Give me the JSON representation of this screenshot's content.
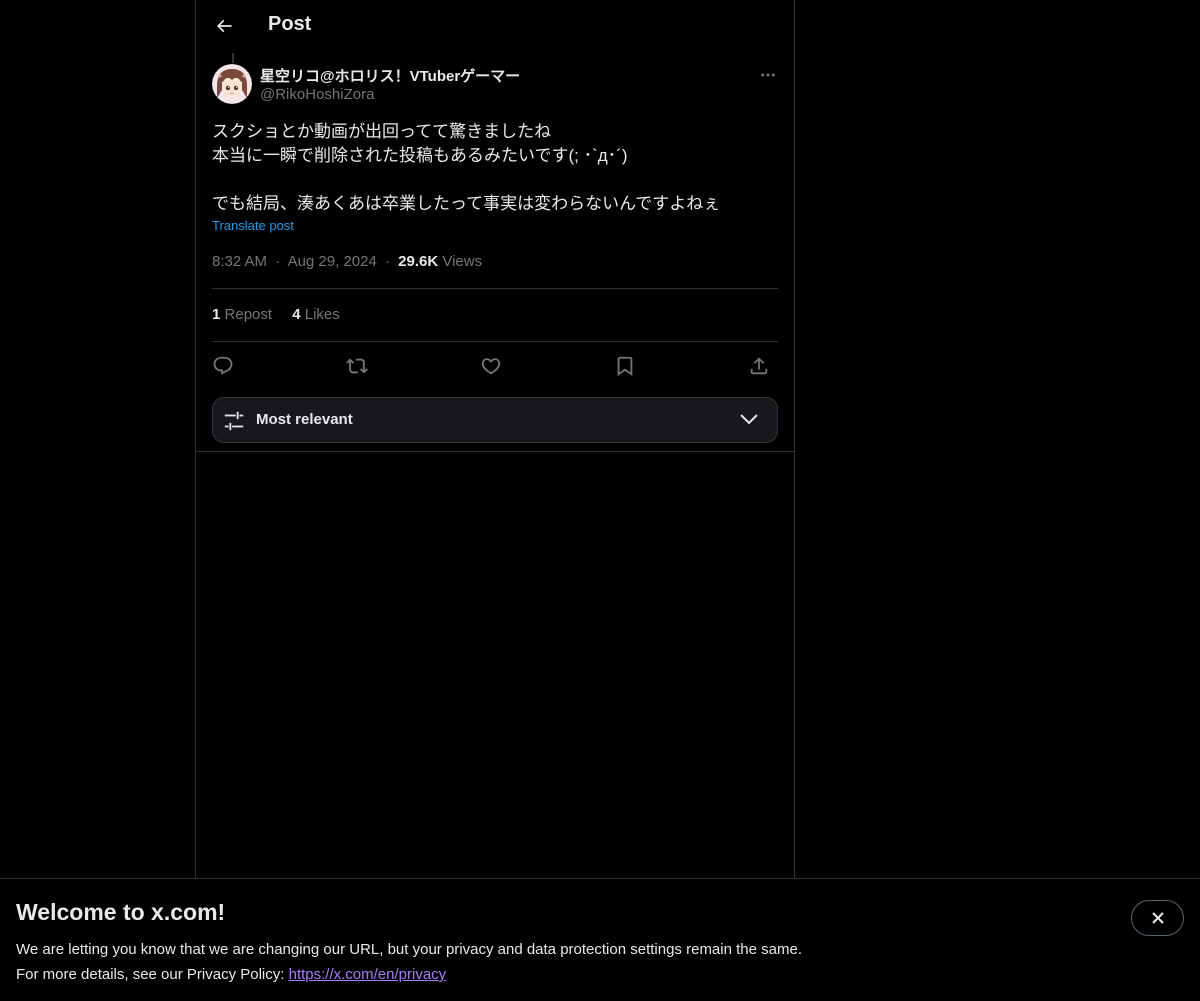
{
  "header": {
    "title": "Post"
  },
  "post": {
    "display_name": "星空リコ@ホロリス！VTuberゲーマー",
    "handle": "@RikoHoshiZora",
    "text_lines": [
      "スクショとか動画が出回ってて驚きましたね",
      "本当に一瞬で削除された投稿もあるみたいです(; ･`д･´)",
      "",
      "でも結局、湊あくあは卒業したって事実は変わらないんですよねぇ"
    ],
    "translate_label": "Translate post",
    "time": "8:32 AM",
    "date": "Aug 29, 2024",
    "views_count": "29.6K",
    "views_label": "Views",
    "separator": "·"
  },
  "stats": {
    "reposts_count": "1",
    "reposts_label": "Repost",
    "likes_count": "4",
    "likes_label": "Likes"
  },
  "actions": {
    "icons": [
      "reply-icon",
      "retweet-icon",
      "like-icon",
      "bookmark-icon",
      "share-icon"
    ]
  },
  "sort": {
    "label": "Most relevant"
  },
  "banner": {
    "title": "Welcome to x.com!",
    "line1": "We are letting you know that we are changing our URL, but your privacy and data protection settings remain the same.",
    "line2_prefix": "For more details, see our Privacy Policy:",
    "link": "https://x.com/en/privacy"
  },
  "colors": {
    "background": "#000000",
    "text": "#e7e9ea",
    "muted": "#71767b",
    "accent": "#1d9bf0",
    "border": "#2f3336",
    "link_visited": "#a97cf8"
  }
}
